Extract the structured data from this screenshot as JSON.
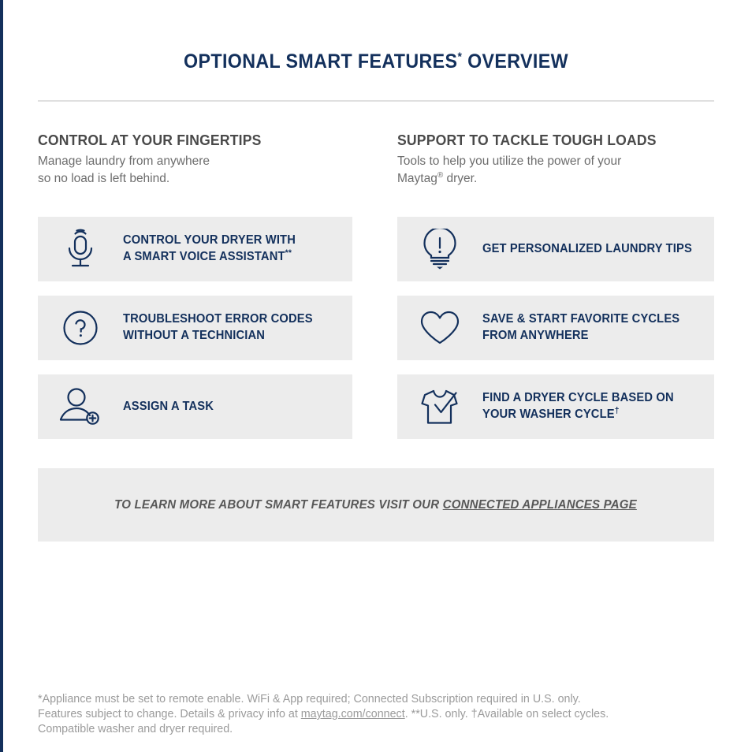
{
  "page": {
    "title_main": "OPTIONAL SMART FEATURES",
    "title_marker": "*",
    "title_tail": " OVERVIEW",
    "accent_navy": "#13305c",
    "card_bg": "#ececec",
    "heading_gray": "#4a4a4a",
    "body_gray": "#6d6d6d",
    "footnote_gray": "#9b9b9b"
  },
  "columns": {
    "left": {
      "heading": "CONTROL AT YOUR FINGERTIPS",
      "body_line1": "Manage laundry from anywhere",
      "body_line2": "so no load is left behind.",
      "cards": [
        {
          "icon": "microphone-icon",
          "line1": "CONTROL YOUR DRYER WITH",
          "line2": "A SMART VOICE ASSISTANT",
          "marker": "**"
        },
        {
          "icon": "question-circle-icon",
          "line1": "TROUBLESHOOT ERROR CODES",
          "line2": "WITHOUT A TECHNICIAN",
          "marker": ""
        },
        {
          "icon": "person-add-icon",
          "line1": "ASSIGN A TASK",
          "line2": "",
          "marker": ""
        }
      ]
    },
    "right": {
      "heading": "SUPPORT TO TACKLE TOUGH LOADS",
      "body_line1": "Tools to help you utilize the power of your",
      "body_line2_pre": "Maytag",
      "body_line2_reg": "®",
      "body_line2_post": " dryer.",
      "cards": [
        {
          "icon": "lightbulb-alert-icon",
          "line1": "GET PERSONALIZED LAUNDRY TIPS",
          "line2": "",
          "marker": ""
        },
        {
          "icon": "heart-icon",
          "line1": "SAVE & START FAVORITE CYCLES",
          "line2": "FROM ANYWHERE",
          "marker": ""
        },
        {
          "icon": "tshirt-check-icon",
          "line1": "FIND A DRYER CYCLE BASED ON",
          "line2": "YOUR WASHER CYCLE",
          "marker": "†"
        }
      ]
    }
  },
  "cta": {
    "text": "TO LEARN MORE ABOUT SMART FEATURES VISIT OUR ",
    "link_text": "CONNECTED APPLIANCES PAGE"
  },
  "footnotes": {
    "line1": "*Appliance must be set to remote enable. WiFi & App required; Connected Subscription required in U.S. only.",
    "line2_pre": "Features subject to change. Details & privacy info at ",
    "line2_link": "maytag.com/connect",
    "line2_post": ". **U.S. only. †Available on select cycles.",
    "line3": "Compatible washer and dryer required."
  }
}
